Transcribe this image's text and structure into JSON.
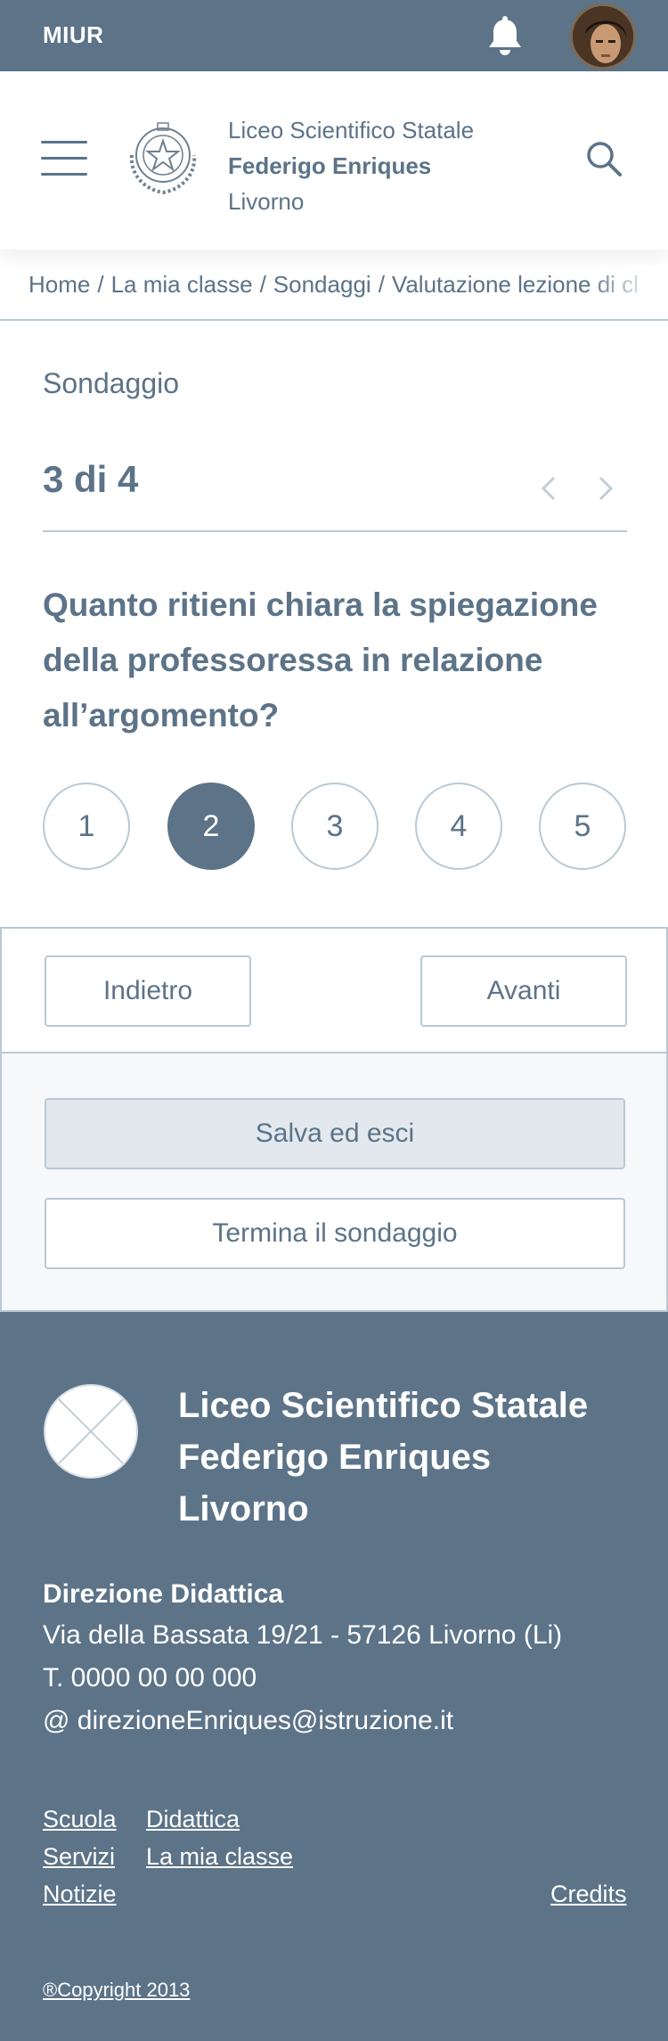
{
  "topbar": {
    "brand": "MIUR",
    "notifications_icon": "bell-icon",
    "avatar_icon": "user-avatar"
  },
  "header": {
    "menu_icon": "hamburger-menu-icon",
    "emblem_icon": "italian-republic-emblem",
    "school_line1": "Liceo Scientifico Statale",
    "school_line2": "Federigo Enriques",
    "school_line3": "Livorno",
    "search_icon": "search-icon"
  },
  "breadcrumb": {
    "items": [
      "Home",
      "La mia classe",
      "Sondaggi",
      "Valutazione lezione di cl"
    ]
  },
  "survey": {
    "label": "Sondaggio",
    "progress": "3 di 4",
    "question": "Quanto ritieni chiara la spiegazione della professoressa in relazione all’argomento?",
    "options": [
      "1",
      "2",
      "3",
      "4",
      "5"
    ],
    "selected": "2",
    "back_label": "Indietro",
    "next_label": "Avanti",
    "save_label": "Salva ed esci",
    "end_label": "Termina il sondaggio"
  },
  "footer": {
    "title_line1": "Liceo Scientifico Statale",
    "title_line2": "Federigo Enriques",
    "title_line3": "Livorno",
    "direction": "Direzione Didattica",
    "address": "Via della Bassata 19/21 - 57126 Livorno (Li)",
    "phone": "T. 0000 00 00 000",
    "email": "@ direzioneEnriques@istruzione.it",
    "links": [
      "Scuola",
      "Didattica",
      "Servizi",
      "La mia classe",
      "Notizie"
    ],
    "credits": "Credits",
    "copyright": "®Copyright 2013"
  },
  "colors": {
    "primary": "#5c7388",
    "border": "#b8c9d4",
    "panel_bg": "#f6f8f9",
    "save_bg": "#e2e8ee"
  }
}
